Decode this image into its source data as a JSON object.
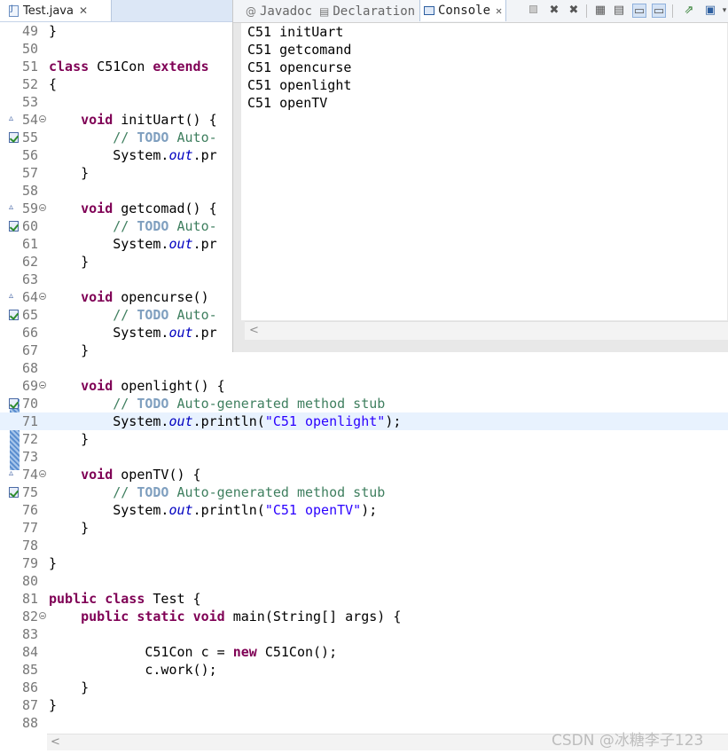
{
  "editor_tab": {
    "label": "Test.java",
    "close": "✕"
  },
  "console_view": {
    "tabs": {
      "javadoc": "Javadoc",
      "declaration": "Declaration",
      "console": "Console"
    },
    "tab_close": "✕",
    "output": [
      "C51 initUart",
      "C51 getcomand",
      "C51 opencurse",
      "C51 openlight",
      "C51 openTV"
    ],
    "scroll_arrow": "<"
  },
  "editor": {
    "line_numbers": [
      "49",
      "50",
      "51",
      "52",
      "53",
      "54",
      "55",
      "56",
      "57",
      "58",
      "59",
      "60",
      "61",
      "62",
      "63",
      "64",
      "65",
      "66",
      "67",
      "68",
      "69",
      "70",
      "71",
      "72",
      "73",
      "74",
      "75",
      "76",
      "77",
      "78",
      "79",
      "80",
      "81",
      "82",
      "83",
      "84",
      "85",
      "86",
      "87",
      "88"
    ],
    "code": {
      "l49": "}",
      "l51_kw1": "class",
      "l51_text": " C51Con ",
      "l51_kw2": "extends",
      "l52": "{",
      "void": "void",
      "l54_text": " initUart() {",
      "comment_prefix": "// ",
      "todo": "TODO",
      "comment_short": " Auto-",
      "comment_full": " Auto-generated method stub",
      "system": "System.",
      "out": "out",
      "print_short": ".pr",
      "println_open": ".println(",
      "println_close": ");",
      "brace_close": "}",
      "l59_text": " getcomad() {",
      "l64_text": " opencurse()",
      "l69_text": " openlight() {",
      "l71_str": "\"C51 openlight\"",
      "l74_text": " openTV() {",
      "l76_str": "\"C51 openTV\"",
      "l81_kw1": "public",
      "l81_kw2": "class",
      "l81_text": " Test {",
      "l82_kw1": "public",
      "l82_kw2": "static",
      "l82_kw3": "void",
      "l82_text": " main(String[] args) {",
      "l84_a": "C51Con c = ",
      "l84_kw": "new",
      "l84_b": " C51Con();",
      "l85": "c.work();"
    },
    "scroll_arrow": "<"
  },
  "watermark": "CSDN @冰糖李子123",
  "colors": {
    "keyword": "#7f0055",
    "comment": "#3f7f5f",
    "todo": "#7f9fbf",
    "field": "#0000c0",
    "string": "#2a00ff",
    "current_line": "#e8f2fe"
  },
  "icons": [
    "java-file-icon",
    "at-javadoc-icon",
    "declaration-icon",
    "console-monitor-icon",
    "terminate-icon",
    "remove-launch-icon",
    "remove-all-icon",
    "scroll-lock-icon",
    "show-on-output-icon",
    "pin-console-icon",
    "new-console-icon",
    "view-menu-icon",
    "override-marker-icon",
    "task-marker-icon",
    "fold-icon"
  ]
}
